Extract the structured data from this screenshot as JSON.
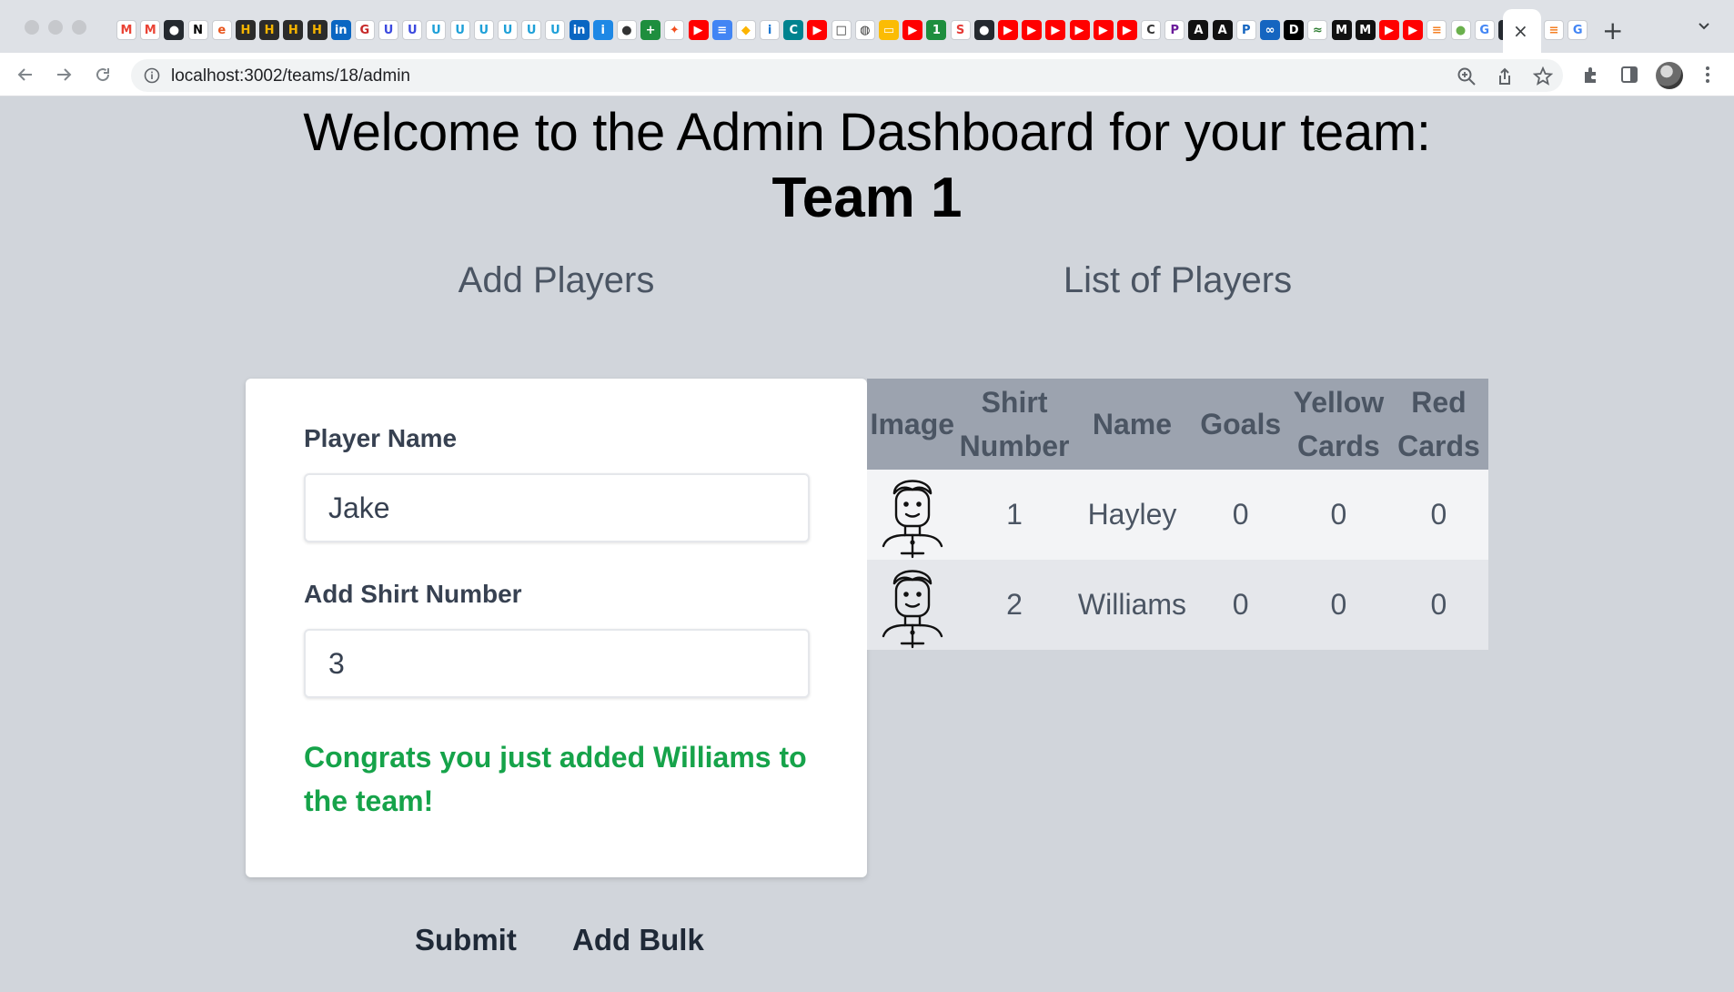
{
  "browser": {
    "url": "localhost:3002/teams/18/admin",
    "tab_close_glyph": "×",
    "new_tab_glyph": "+",
    "tab_favicons": [
      {
        "icon": "gmail-icon",
        "glyph": "M",
        "bg": "#ffffff",
        "fg": "#ea4335"
      },
      {
        "icon": "gmail-icon",
        "glyph": "M",
        "bg": "#ffffff",
        "fg": "#ea4335"
      },
      {
        "icon": "github-icon",
        "glyph": "●",
        "bg": "#24292f",
        "fg": "#ffffff"
      },
      {
        "icon": "notion-icon",
        "glyph": "N",
        "bg": "#ffffff",
        "fg": "#000000"
      },
      {
        "icon": "edge-icon",
        "glyph": "e",
        "bg": "#ffffff",
        "fg": "#e8541c"
      },
      {
        "icon": "hackerrank-icon",
        "glyph": "H",
        "bg": "#2b2b2b",
        "fg": "#f5b400"
      },
      {
        "icon": "hackerrank-icon",
        "glyph": "H",
        "bg": "#2b2b2b",
        "fg": "#f5b400"
      },
      {
        "icon": "hackerrank-icon",
        "glyph": "H",
        "bg": "#2b2b2b",
        "fg": "#f5b400"
      },
      {
        "icon": "hackerrank-icon",
        "glyph": "H",
        "bg": "#2b2b2b",
        "fg": "#f5b400"
      },
      {
        "icon": "linkedin-icon",
        "glyph": "in",
        "bg": "#0a66c2",
        "fg": "#ffffff"
      },
      {
        "icon": "site-icon",
        "glyph": "G",
        "bg": "#ffffff",
        "fg": "#c62828"
      },
      {
        "icon": "udemy-icon",
        "glyph": "U",
        "bg": "#ffffff",
        "fg": "#3b49df"
      },
      {
        "icon": "udemy-icon",
        "glyph": "U",
        "bg": "#ffffff",
        "fg": "#3b49df"
      },
      {
        "icon": "udemy-icon",
        "glyph": "U",
        "bg": "#ffffff",
        "fg": "#1ea0d8"
      },
      {
        "icon": "udemy-icon",
        "glyph": "U",
        "bg": "#ffffff",
        "fg": "#1ea0d8"
      },
      {
        "icon": "udemy-icon",
        "glyph": "U",
        "bg": "#ffffff",
        "fg": "#1ea0d8"
      },
      {
        "icon": "udemy-icon",
        "glyph": "U",
        "bg": "#ffffff",
        "fg": "#1ea0d8"
      },
      {
        "icon": "udemy-icon",
        "glyph": "U",
        "bg": "#ffffff",
        "fg": "#1ea0d8"
      },
      {
        "icon": "udemy-icon",
        "glyph": "U",
        "bg": "#ffffff",
        "fg": "#1ea0d8"
      },
      {
        "icon": "linkedin-icon",
        "glyph": "in",
        "bg": "#0a66c2",
        "fg": "#ffffff"
      },
      {
        "icon": "info-site-icon",
        "glyph": "i",
        "bg": "#1e88e5",
        "fg": "#ffffff"
      },
      {
        "icon": "circle-site-icon",
        "glyph": "●",
        "bg": "#ffffff",
        "fg": "#333333"
      },
      {
        "icon": "plus-site-icon",
        "glyph": "+",
        "bg": "#1e8e3e",
        "fg": "#ffffff"
      },
      {
        "icon": "figma-icon",
        "glyph": "✦",
        "bg": "#ffffff",
        "fg": "#f24e1e"
      },
      {
        "icon": "youtube-icon",
        "glyph": "▶",
        "bg": "#ff0000",
        "fg": "#ffffff"
      },
      {
        "icon": "docs-icon",
        "glyph": "≡",
        "bg": "#4285f4",
        "fg": "#ffffff"
      },
      {
        "icon": "airtable-icon",
        "glyph": "◆",
        "bg": "#ffffff",
        "fg": "#fcb400"
      },
      {
        "icon": "info-site-icon",
        "glyph": "i",
        "bg": "#ffffff",
        "fg": "#1976d2"
      },
      {
        "icon": "c-site-icon",
        "glyph": "C",
        "bg": "#00838f",
        "fg": "#ffffff"
      },
      {
        "icon": "youtube-icon",
        "glyph": "▶",
        "bg": "#ff0000",
        "fg": "#ffffff"
      },
      {
        "icon": "square-site-icon",
        "glyph": "□",
        "bg": "#ffffff",
        "fg": "#333333"
      },
      {
        "icon": "globe-icon",
        "glyph": "◍",
        "bg": "#ffffff",
        "fg": "#333333"
      },
      {
        "icon": "slides-icon",
        "glyph": "▭",
        "bg": "#fbbc04",
        "fg": "#ffffff"
      },
      {
        "icon": "youtube-icon",
        "glyph": "▶",
        "bg": "#ff0000",
        "fg": "#ffffff"
      },
      {
        "icon": "one-site-icon",
        "glyph": "1",
        "bg": "#1e8e3e",
        "fg": "#ffffff"
      },
      {
        "icon": "s-site-icon",
        "glyph": "S",
        "bg": "#ffffff",
        "fg": "#e53935"
      },
      {
        "icon": "github-icon",
        "glyph": "●",
        "bg": "#24292f",
        "fg": "#ffffff"
      },
      {
        "icon": "youtube-icon",
        "glyph": "▶",
        "bg": "#ff0000",
        "fg": "#ffffff"
      },
      {
        "icon": "youtube-icon",
        "glyph": "▶",
        "bg": "#ff0000",
        "fg": "#ffffff"
      },
      {
        "icon": "youtube-icon",
        "glyph": "▶",
        "bg": "#ff0000",
        "fg": "#ffffff"
      },
      {
        "icon": "youtube-icon",
        "glyph": "▶",
        "bg": "#ff0000",
        "fg": "#ffffff"
      },
      {
        "icon": "youtube-icon",
        "glyph": "▶",
        "bg": "#ff0000",
        "fg": "#ffffff"
      },
      {
        "icon": "youtube-icon",
        "glyph": "▶",
        "bg": "#ff0000",
        "fg": "#ffffff"
      },
      {
        "icon": "c-site-icon",
        "glyph": "C",
        "bg": "#ffffff",
        "fg": "#333333"
      },
      {
        "icon": "p-site-icon",
        "glyph": "P",
        "bg": "#ffffff",
        "fg": "#6a1b9a"
      },
      {
        "icon": "dark-site-icon",
        "glyph": "A",
        "bg": "#111111",
        "fg": "#ffffff"
      },
      {
        "icon": "dark-site-icon",
        "glyph": "A",
        "bg": "#111111",
        "fg": "#ffffff"
      },
      {
        "icon": "p-site-icon",
        "glyph": "P",
        "bg": "#ffffff",
        "fg": "#1565c0"
      },
      {
        "icon": "infinity-icon",
        "glyph": "∞",
        "bg": "#1565c0",
        "fg": "#ffffff"
      },
      {
        "icon": "dev-icon",
        "glyph": "D",
        "bg": "#000000",
        "fg": "#ffffff"
      },
      {
        "icon": "code-site-icon",
        "glyph": "≈",
        "bg": "#ffffff",
        "fg": "#2e7d32"
      },
      {
        "icon": "medium-icon",
        "glyph": "M",
        "bg": "#111111",
        "fg": "#ffffff"
      },
      {
        "icon": "medium-icon",
        "glyph": "M",
        "bg": "#111111",
        "fg": "#ffffff"
      },
      {
        "icon": "youtube-icon",
        "glyph": "▶",
        "bg": "#ff0000",
        "fg": "#ffffff"
      },
      {
        "icon": "youtube-icon",
        "glyph": "▶",
        "bg": "#ff0000",
        "fg": "#ffffff"
      },
      {
        "icon": "stackoverflow-icon",
        "glyph": "≡",
        "bg": "#ffffff",
        "fg": "#f48024"
      },
      {
        "icon": "leaf-icon",
        "glyph": "●",
        "bg": "#ffffff",
        "fg": "#6ab04c"
      },
      {
        "icon": "google-icon",
        "glyph": "G",
        "bg": "#ffffff",
        "fg": "#4285f4"
      },
      {
        "icon": "github-icon",
        "glyph": "●",
        "bg": "#24292f",
        "fg": "#ffffff"
      }
    ],
    "trailing_favicons": [
      {
        "icon": "stackoverflow-icon",
        "glyph": "≡",
        "bg": "#ffffff",
        "fg": "#f48024"
      },
      {
        "icon": "google-icon",
        "glyph": "G",
        "bg": "#ffffff",
        "fg": "#4285f4"
      }
    ]
  },
  "page": {
    "heading_line1": "Welcome to the Admin Dashboard for your team:",
    "team_name": "Team 1",
    "add_players_title": "Add Players",
    "list_players_title": "List of Players"
  },
  "form": {
    "player_name_label": "Player Name",
    "player_name_value": "Jake",
    "shirt_number_label": "Add Shirt Number",
    "shirt_number_value": "3",
    "success_message": "Congrats you just added Williams to the team!"
  },
  "actions": {
    "submit_label": "Submit",
    "add_bulk_label": "Add Bulk"
  },
  "table": {
    "headers": {
      "image": "Image",
      "shirt_line1": "Shirt",
      "shirt_line2": "Number",
      "name": "Name",
      "goals": "Goals",
      "yellow_line1": "Yellow",
      "yellow_line2": "Cards",
      "red_line1": "Red",
      "red_line2": "Cards"
    },
    "rows": [
      {
        "shirt": "1",
        "name": "Hayley",
        "goals": "0",
        "yellow": "0",
        "red": "0"
      },
      {
        "shirt": "2",
        "name": "Williams",
        "goals": "0",
        "yellow": "0",
        "red": "0"
      }
    ]
  },
  "colors": {
    "page_bg": "#d1d5db",
    "table_header_bg": "#9ca3af",
    "success_text": "#16a34a"
  }
}
